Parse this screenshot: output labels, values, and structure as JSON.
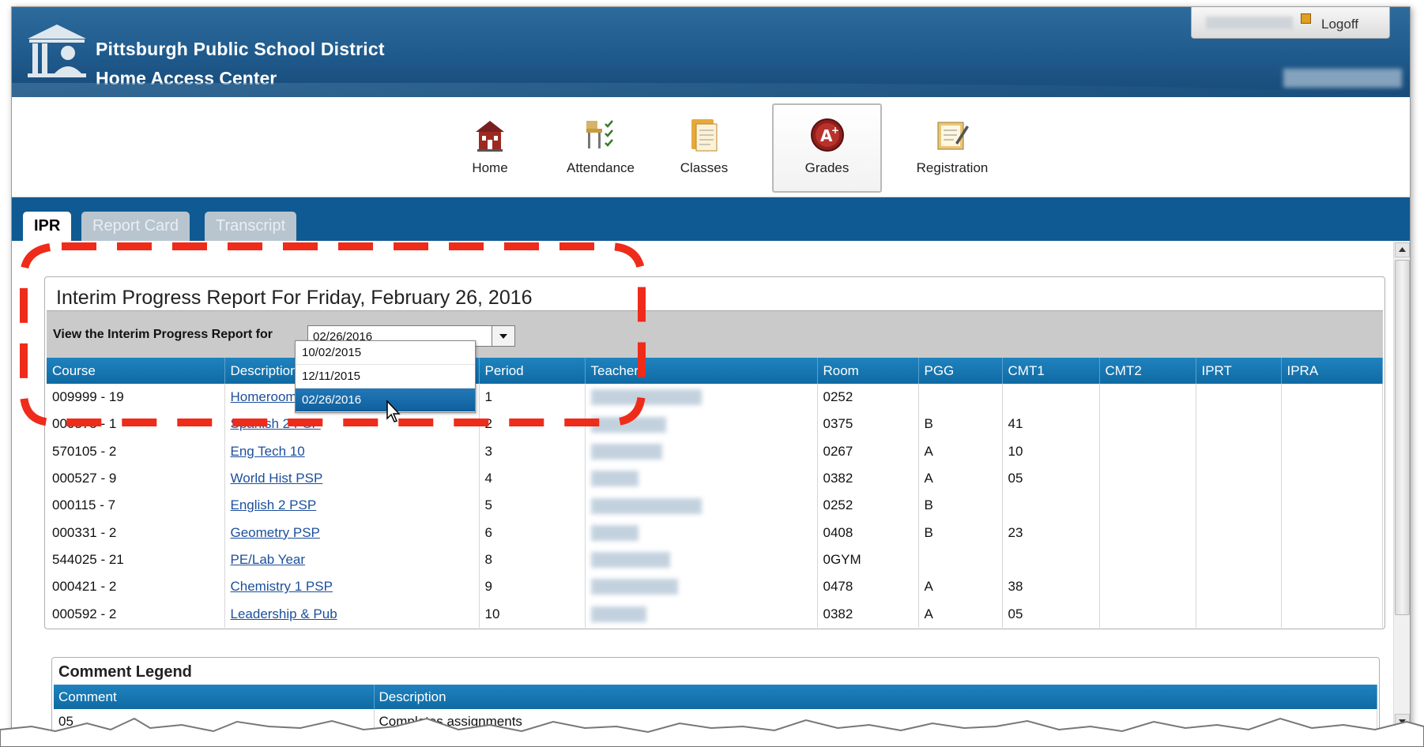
{
  "header": {
    "district": "Pittsburgh Public School District",
    "app": "Home Access Center",
    "logoff": "Logoff"
  },
  "nav": [
    {
      "label": "Home",
      "icon": "schoolhouse-icon"
    },
    {
      "label": "Attendance",
      "icon": "attendance-desk-icon"
    },
    {
      "label": "Classes",
      "icon": "clipboard-icon"
    },
    {
      "label": "Grades",
      "icon": "a-plus-badge-icon",
      "active": true
    },
    {
      "label": "Registration",
      "icon": "registration-form-icon"
    }
  ],
  "tabs": [
    {
      "label": "IPR",
      "active": true
    },
    {
      "label": "Report Card",
      "active": false
    },
    {
      "label": "Transcript",
      "active": false
    }
  ],
  "ipr": {
    "title": "Interim Progress Report For Friday, February 26, 2016",
    "filter_label": "View the Interim Progress Report for",
    "selected_date": "02/26/2016",
    "date_options": [
      "10/02/2015",
      "12/11/2015",
      "02/26/2016"
    ]
  },
  "table": {
    "headers": [
      "Course",
      "Description",
      "Period",
      "Teacher",
      "Room",
      "PGG",
      "CMT1",
      "CMT2",
      "IPRT",
      "IPRA"
    ],
    "rows": [
      {
        "course": "009999 - 19",
        "description": "Homeroom",
        "period": "1",
        "room": "0252",
        "pgg": "",
        "cmt1": ""
      },
      {
        "course": "000375 - 1",
        "description": "Spanish 2 PSP",
        "period": "2",
        "room": "0375",
        "pgg": "B",
        "cmt1": "41"
      },
      {
        "course": "570105 - 2",
        "description": "Eng Tech 10",
        "period": "3",
        "room": "0267",
        "pgg": "A",
        "cmt1": "10"
      },
      {
        "course": "000527 - 9",
        "description": "World Hist PSP",
        "period": "4",
        "room": "0382",
        "pgg": "A",
        "cmt1": "05"
      },
      {
        "course": "000115 - 7",
        "description": "English 2 PSP",
        "period": "5",
        "room": "0252",
        "pgg": "B",
        "cmt1": ""
      },
      {
        "course": "000331 - 2",
        "description": "Geometry PSP",
        "period": "6",
        "room": "0408",
        "pgg": "B",
        "cmt1": "23"
      },
      {
        "course": "544025 - 21",
        "description": "PE/Lab Year",
        "period": "8",
        "room": "0GYM",
        "pgg": "",
        "cmt1": ""
      },
      {
        "course": "000421 - 2",
        "description": "Chemistry 1 PSP",
        "period": "9",
        "room": "0478",
        "pgg": "A",
        "cmt1": "38"
      },
      {
        "course": "000592 - 2",
        "description": "Leadership & Pub",
        "period": "10",
        "room": "0382",
        "pgg": "A",
        "cmt1": "05"
      }
    ]
  },
  "legend": {
    "title": "Comment Legend",
    "headers": [
      "Comment",
      "Description"
    ],
    "rows": [
      {
        "comment": "05",
        "description": "Completes assignments"
      }
    ]
  },
  "colors": {
    "banner": "#1f5a8c",
    "table_header": "#1177b5",
    "annotation": "#ef2b1a"
  }
}
